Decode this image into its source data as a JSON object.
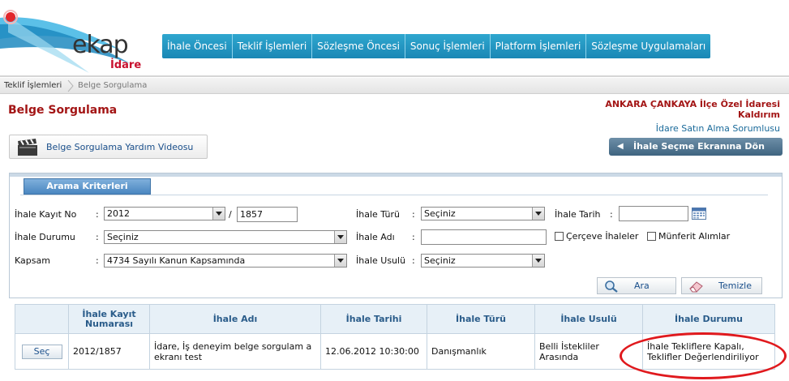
{
  "brand": {
    "logo": "ekap",
    "sub": "İdare"
  },
  "topnav": [
    "İhale Öncesi",
    "Teklif İşlemleri",
    "Sözleşme Öncesi",
    "Sonuç İşlemleri",
    "Platform İşlemleri",
    "Sözleşme Uygulamaları"
  ],
  "breadcrumb": [
    "Teklif İşlemleri",
    "Belge Sorgulama"
  ],
  "page": {
    "title": "Belge Sorgulama",
    "org_name": "ANKARA ÇANKAYA İlçe Özel İdaresi Kaldırım",
    "org_role": "İdare Satın Alma Sorumlusu",
    "help_label": "Belge Sorgulama Yardım Videosu",
    "back_label": "İhale Seçme Ekranına Dön"
  },
  "search": {
    "tab_label": "Arama Kriterleri",
    "kayit_no_label": "İhale Kayıt No",
    "kayit_year": "2012",
    "kayit_sep": "/",
    "kayit_number": "1857",
    "durum_label": "İhale Durumu",
    "durum_value": "Seçiniz",
    "kapsam_label": "Kapsam",
    "kapsam_value": "4734 Sayılı Kanun Kapsamında",
    "turu_label": "İhale Türü",
    "turu_value": "Seçiniz",
    "adi_label": "İhale Adı",
    "adi_value": "",
    "usulu_label": "İhale Usulü",
    "usulu_value": "Seçiniz",
    "tarih_label": "İhale Tarih",
    "tarih_value": "",
    "colon": ":",
    "cerceve_label": "Çerçeve İhaleler",
    "munferit_label": "Münferit Alımlar",
    "search_btn": "Ara",
    "clear_btn": "Temizle"
  },
  "results": {
    "headers": [
      "",
      "İhale Kayıt Numarası",
      "İhale Adı",
      "İhale Tarihi",
      "İhale Türü",
      "İhale Usulü",
      "İhale Durumu"
    ],
    "rows": [
      {
        "select": "Seç",
        "kayit": "2012/1857",
        "adi": "İdare, İş deneyim belge sorgulam a ekranı test",
        "tarih": "12.06.2012 10:30:00",
        "turu": "Danışmanlık",
        "usulu": "Belli İstekliler Arasında",
        "durum": "İhale Tekliflere Kapalı, Teklifler Değerlendiriliyor"
      }
    ]
  },
  "colors": {
    "nav": "#1a87b5",
    "title": "#a31515",
    "highlight": "#e0191d"
  },
  "icons": [
    "clapperboard-icon",
    "arrow-left-icon",
    "calendar-icon",
    "magnifier-icon",
    "eraser-icon",
    "breadcrumb-separator-icon"
  ]
}
